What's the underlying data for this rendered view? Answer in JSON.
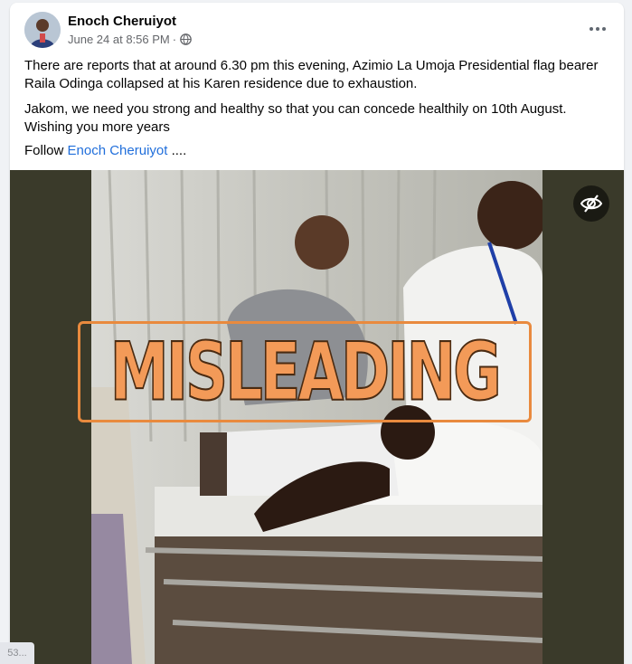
{
  "post": {
    "author": "Enoch Cheruiyot",
    "timestamp": "June 24 at 8:56 PM",
    "separator": "·",
    "privacy_icon": "globe-icon",
    "more_icon": "more-options-icon",
    "paragraphs": [
      "There are reports that at around 6.30 pm this evening, Azimio La Umoja Presidential flag bearer Raila Odinga collapsed at his Karen residence due to exhaustion.",
      "Jakom, we need you strong and healthy so that you can concede healthily on 10th August.",
      "Wishing you more years"
    ],
    "follow_prefix": "Follow ",
    "follow_link": "Enoch Cheruiyot",
    "follow_suffix": " ...."
  },
  "media": {
    "overlay_label": "MISLEADING",
    "overlay_color": "#f39a58",
    "hide_icon": "eye-slash-icon"
  },
  "corner_badge": "53..."
}
